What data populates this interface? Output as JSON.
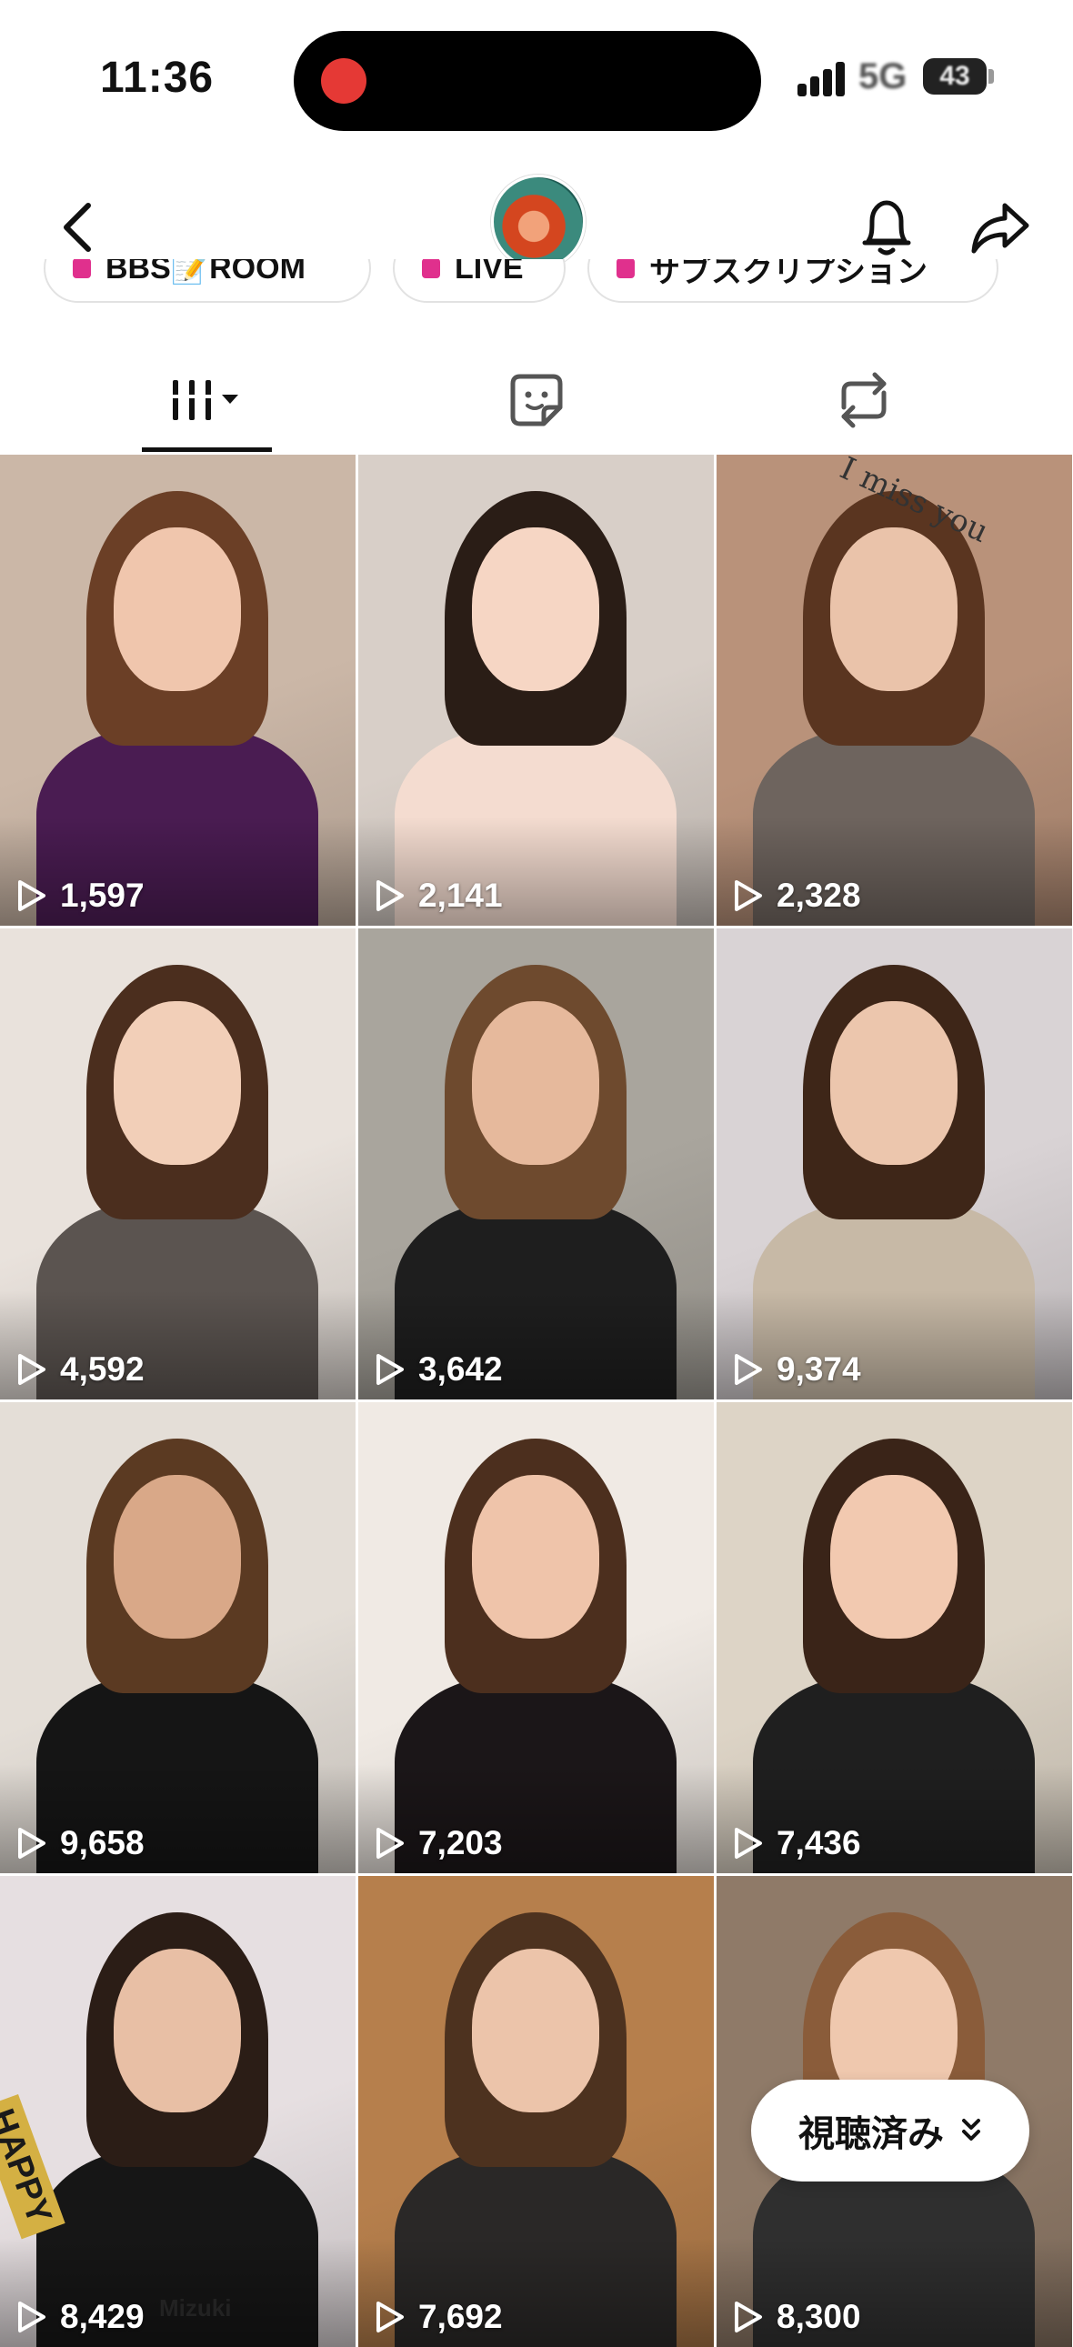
{
  "status_bar": {
    "time": "11:36",
    "network": "5G",
    "battery": "43"
  },
  "header": {
    "avatar_alt": "profile avatar"
  },
  "pills": [
    {
      "label": "BBS📝ROOM"
    },
    {
      "label": "LIVE"
    },
    {
      "label": "サブスクリプション"
    }
  ],
  "tabs": [
    "videos",
    "liked",
    "reposts"
  ],
  "videos": [
    {
      "views": "1,597",
      "bg": "#cbb7a7",
      "hair": "#6b3f26",
      "body": "#4a1c52",
      "skin": "#f0c6ad"
    },
    {
      "views": "2,141",
      "bg": "#d8cfc8",
      "hair": "#2a1d16",
      "body": "#f4dcd0",
      "skin": "#f6d6c4"
    },
    {
      "views": "2,328",
      "bg": "#b9927a",
      "hair": "#5a3520",
      "body": "#6e645e",
      "skin": "#eac3aa"
    },
    {
      "views": "4,592",
      "bg": "#e9e2dc",
      "hair": "#4b2e1e",
      "body": "#5b5450",
      "skin": "#f2cfb8"
    },
    {
      "views": "3,642",
      "bg": "#a9a59d",
      "hair": "#6e4a2e",
      "body": "#1e1e1e",
      "skin": "#e6b99c"
    },
    {
      "views": "9,374",
      "bg": "#d9d3d5",
      "hair": "#3e2618",
      "body": "#c7b9a6",
      "skin": "#ecc6ad"
    },
    {
      "views": "9,658",
      "bg": "#e4ded7",
      "hair": "#5b3a22",
      "body": "#151515",
      "skin": "#d9a888"
    },
    {
      "views": "7,203",
      "bg": "#f0eae4",
      "hair": "#4c2f1e",
      "body": "#1b1618",
      "skin": "#efc4aa"
    },
    {
      "views": "7,436",
      "bg": "#ddd4c6",
      "hair": "#3a2418",
      "body": "#1f1f1f",
      "skin": "#f2c9b0"
    },
    {
      "views": "8,429",
      "bg": "#e6dfe1",
      "hair": "#2b1d16",
      "body": "#161616",
      "skin": "#e8bfa5"
    },
    {
      "views": "7,692",
      "bg": "#b67f4c",
      "hair": "#4d321f",
      "body": "#2a2827",
      "skin": "#ecc4aa"
    },
    {
      "views": "8,300",
      "bg": "#8f7a68",
      "hair": "#8a5c3a",
      "body": "#2f2f2f",
      "skin": "#efc8ae"
    }
  ],
  "overlay_texts": {
    "tile3": "I miss you",
    "tile10_banner": "HAPPY",
    "tile10_cake": "Mizuki"
  },
  "watched_button": {
    "label": "視聴済み"
  },
  "colors": {
    "accent_pink": "#e0308d",
    "rec": "#e53935"
  }
}
